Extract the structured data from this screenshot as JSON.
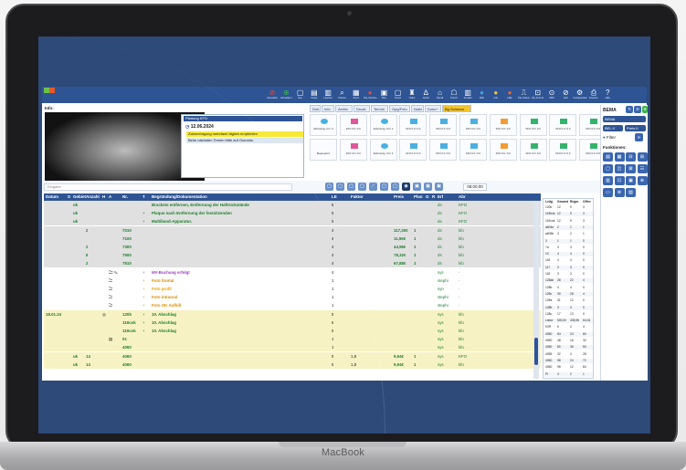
{
  "device": {
    "brand": "MacBook"
  },
  "toolbar": [
    {
      "icon": "⊘",
      "label": "Abmelden",
      "color": "#e24a4a"
    },
    {
      "icon": "⊕",
      "label": "Abmeldern",
      "color": "#39b54a"
    },
    {
      "icon": "▢",
      "label": "Neu"
    },
    {
      "icon": "▤",
      "label": "Kopie"
    },
    {
      "icon": "▥",
      "label": "Löschen"
    },
    {
      "icon": "⌕",
      "label": "Suchen"
    },
    {
      "icon": "▦",
      "label": "Zoom"
    },
    {
      "icon": "●",
      "label": "Pat. löschen",
      "color": "#e24a4a"
    },
    {
      "icon": "▣",
      "label": "Plan"
    },
    {
      "icon": "▢",
      "label": "Druck"
    },
    {
      "icon": "♜",
      "label": "Video"
    },
    {
      "icon": "∆",
      "label": "Aufruf"
    },
    {
      "icon": "⌂",
      "label": "Recall"
    },
    {
      "icon": "☖",
      "label": "Termin"
    },
    {
      "icon": "▥",
      "label": "Kontakt"
    },
    {
      "icon": "●",
      "label": "Web",
      "color": "#4aa3df"
    },
    {
      "icon": "●",
      "label": "Info",
      "color": "#f5c431"
    },
    {
      "icon": "●",
      "label": "Hilfe",
      "color": "#e86a2b"
    },
    {
      "icon": "⎍",
      "label": "Pat.-Status"
    },
    {
      "icon": "⊡",
      "label": "Bg Journal"
    },
    {
      "icon": "⊙",
      "label": "SMS"
    },
    {
      "icon": "⊘",
      "label": "HuK"
    },
    {
      "icon": "⚙",
      "label": "Konfiguration"
    },
    {
      "icon": "⎙",
      "label": "Drucken"
    },
    {
      "icon": "?",
      "label": "Hilfe"
    }
  ],
  "info_label": "Info:",
  "plan": {
    "title": "Planung KFO",
    "date": "12.06.2024",
    "lines": [
      {
        "text": "Zahnreinigung mehrfach täglich empfohlen",
        "bg": "#f7ea36"
      },
      {
        "text": "Beim nächsten Termin bitte auf Gummis",
        "bg": "#dde6f3"
      }
    ]
  },
  "tabs": [
    {
      "label": "Dok"
    },
    {
      "label": "Info"
    },
    {
      "label": "Archiv"
    },
    {
      "label": "Druck"
    },
    {
      "label": "Termin"
    },
    {
      "label": "Opg/Foto"
    },
    {
      "label": "Notiz"
    },
    {
      "label": "Doku+"
    },
    {
      "label": "Bg Schema",
      "active": true
    }
  ],
  "cards": [
    {
      "label": "Zahnreinig. 0.0 / 4",
      "color": "#4bb0e0"
    },
    {
      "label": "KFO 0.0 / 0.0",
      "color": "#e0569b"
    },
    {
      "label": "Zahnreinig. 0.0 / 4",
      "color": "#4bb0e0"
    },
    {
      "label": "KFO 0.0 / 0.0",
      "color": "#4bb0e0"
    },
    {
      "label": "KFO 0.0 / 0.0",
      "color": "#4bb0e0"
    },
    {
      "label": "KFO 0.0 / 0.0",
      "color": "#4bb0e0"
    },
    {
      "label": "KFO 0.0 / 0.0",
      "color": "#f39c32"
    },
    {
      "label": "KFO 0.0 / 0.0",
      "color": "#33b36b"
    },
    {
      "label": "KFO 0.0 / 0.0",
      "color": "#33b36b"
    },
    {
      "label": "KFO 0.0 / 0.0",
      "color": "#33b36b"
    },
    {
      "label": "Bugel-geloz",
      "color": "#ffffff"
    },
    {
      "label": "KFO 0.0 / 0.0",
      "color": "#e0569b"
    },
    {
      "label": "Zahnreinig. 0.0 / 4",
      "color": "#4bb0e0"
    },
    {
      "label": "KFO 0.0 / 0.0",
      "color": "#4bb0e0"
    },
    {
      "label": "KFO 0.0 / 0.0",
      "color": "#4bb0e0"
    },
    {
      "label": "KFO 0.0 / 0.0",
      "color": "#4bb0e0"
    },
    {
      "label": "KFO 0.0 / 0.0",
      "color": "#f39c32"
    },
    {
      "label": "KFO 0.0 / 0.0",
      "color": "#33b36b"
    },
    {
      "label": "KFO 0.0 / 0.0",
      "color": "#33b36b"
    },
    {
      "label": "KFO 0.0 / 0.0",
      "color": "#33b36b"
    }
  ],
  "bema": {
    "label": "BEMA",
    "select1": "BEMA",
    "select2": "BEL II",
    "select3": "Preis II",
    "filter": "Filter",
    "functions": "Funktionen:"
  },
  "search": {
    "placeholder": "Eingabe",
    "time": "08:00:00"
  },
  "columns": [
    "Datum",
    "S",
    "Gebiet",
    "Anzahl",
    "H",
    "A",
    "Nr.",
    "T",
    "Begründung/Dokumentation",
    "LE",
    "Faktor",
    "Preis",
    "Plan",
    "G",
    "R",
    "Erf",
    "Abr"
  ],
  "rows": [
    {
      "bg": "#e0e0e0",
      "gebiet": "ok",
      "nr": "",
      "t": "",
      "text": "Brackets entfernen, Entfernung der Haftrückstände",
      "le": "5",
      "erf": "ds",
      "abr": "KFO",
      "tc": "#1a7f2a"
    },
    {
      "bg": "#e0e0e0",
      "gebiet": "uk",
      "nr": "",
      "t": "+",
      "text": "Plaque nach Entfernung der festsitzenden",
      "le": "5",
      "erf": "ds",
      "abr": "KFO",
      "tc": "#1a7f2a"
    },
    {
      "bg": "#e0e0e0",
      "gebiet": "uk",
      "nr": "",
      "t": "+",
      "text": "Multiband-Apparatur.",
      "le": "5",
      "erf": "ds",
      "abr": "KFO",
      "tc": "#1a7f2a"
    },
    {
      "bg": "#e0e0e0",
      "anzahl": "2",
      "nr": "7010",
      "le": "4",
      "preis": "117,30€",
      "plan": "1",
      "erf": "ds",
      "abr": "kfo"
    },
    {
      "bg": "#e0e0e0",
      "nr": "7100",
      "le": "4",
      "preis": "11,55€",
      "plan": "1",
      "erf": "ds",
      "abr": "kfo"
    },
    {
      "bg": "#e0e0e0",
      "anzahl": "2",
      "nr": "7300",
      "le": "4",
      "preis": "44,96€",
      "plan": "1",
      "erf": "ds",
      "abr": "kfo"
    },
    {
      "bg": "#e0e0e0",
      "anzahl": "8",
      "nr": "7500",
      "le": "4",
      "preis": "78,32€",
      "plan": "1",
      "erf": "ds",
      "abr": "kfo"
    },
    {
      "bg": "#e0e0e0",
      "anzahl": "2",
      "nr": "7510",
      "le": "4",
      "preis": "67,88€",
      "plan": "1",
      "erf": "ds",
      "abr": "kfo"
    },
    {
      "bg": "#ffffff",
      "a": "🗀 ✎",
      "t": "+",
      "text": "MV-Buchung erfolgt",
      "le": "4",
      "erf": "sys",
      "abr": "-",
      "tc": "#9c3dba"
    },
    {
      "bg": "#ffffff",
      "a": "🗀",
      "t": "+",
      "text": "Foto frontal",
      "le": "1",
      "erf": "stephi",
      "abr": "-",
      "tc": "#d98a00"
    },
    {
      "bg": "#ffffff",
      "a": "🗀",
      "t": "+",
      "text": "Foto profil",
      "le": "1",
      "erf": "syn",
      "abr": "-",
      "tc": "#e8a200"
    },
    {
      "bg": "#ffffff",
      "a": "🗀",
      "t": "+",
      "text": "Foto intraoral",
      "le": "1",
      "erf": "stephi",
      "abr": "-",
      "tc": "#d98a00"
    },
    {
      "bg": "#ffffff",
      "a": "🗀",
      "t": "+",
      "text": "Foto OK Aufbiß",
      "le": "1",
      "erf": "stephi",
      "abr": "-",
      "tc": "#d98a00"
    },
    {
      "bg": "#f7f2c4",
      "datum": "18.01.24",
      "h": "◎",
      "nr": "120b",
      "t": "+",
      "text": "10. Abschlag",
      "le": "5",
      "erf": "sys",
      "abr": "kfo",
      "tc": "#1a7f2a"
    },
    {
      "bg": "#f7f2c4",
      "nr": "119cok",
      "t": "+",
      "text": "10. Abschlag",
      "le": "5",
      "erf": "sys",
      "abr": "kfo",
      "tc": "#1a7f2a"
    },
    {
      "bg": "#f7f2c4",
      "nr": "119cok",
      "t": "+",
      "text": "10. Abschlag",
      "le": "5",
      "erf": "sys",
      "abr": "kfo",
      "tc": "#1a7f2a"
    },
    {
      "bg": "#f7f2c4",
      "a": "▤",
      "nr": "01",
      "le": "1",
      "erf": "sys",
      "abr": "kfo"
    },
    {
      "bg": "#f7f2c4",
      "nr": "4060",
      "le": "1",
      "erf": "sys",
      "abr": "kfo"
    },
    {
      "bg": "#f7f2c4",
      "gebiet": "uk",
      "anzahl": "14",
      "nr": "4060",
      "le": "5",
      "faktor": "1,8",
      "preis": "9,94€",
      "plan": "1",
      "erf": "sys",
      "abr": "KFO"
    },
    {
      "bg": "#f7f2c4",
      "gebiet": "uk",
      "anzahl": "14",
      "nr": "4060",
      "le": "5",
      "faktor": "1,8",
      "preis": "9,94€",
      "plan": "1",
      "erf": "sys",
      "abr": "kfo"
    }
  ],
  "side_table": {
    "headers": [
      "Leitg",
      "Gesamt",
      "Regm.",
      "Offen"
    ],
    "rows": [
      [
        "120b",
        "12",
        "9",
        "3"
      ],
      [
        "119bok",
        "12",
        "9",
        "3"
      ],
      [
        "119cok",
        "12",
        "9",
        "3"
      ],
      [
        "a604e",
        "2",
        "1",
        "1"
      ],
      [
        "a605b",
        "3",
        "2",
        "1"
      ],
      [
        "3",
        "1",
        "1",
        "0"
      ],
      [
        "7a",
        "3",
        "3",
        "0"
      ],
      [
        "10",
        "4",
        "4",
        "0"
      ],
      [
        "118",
        "4",
        "4",
        "0"
      ],
      [
        "117",
        "3",
        "3",
        "0"
      ],
      [
        "118",
        "3",
        "3",
        "0"
      ],
      [
        "128ab",
        "28",
        "22",
        "4"
      ],
      [
        "128b",
        "4",
        "4",
        "0"
      ],
      [
        "128c",
        "30",
        "28",
        "4"
      ],
      [
        "128a",
        "31",
        "12",
        "0"
      ],
      [
        "128b",
        "3",
        "3",
        "0"
      ],
      [
        "128c",
        "17",
        "13",
        "0"
      ],
      [
        "Labor",
        "500,00",
        "435,96",
        "64,04"
      ],
      [
        "K2R",
        "6",
        "2",
        "4"
      ],
      [
        "4060",
        "84",
        "24",
        "60"
      ],
      [
        "4050",
        "48",
        "16",
        "32"
      ],
      [
        "4050",
        "80",
        "36",
        "60"
      ],
      [
        "4055",
        "32",
        "4",
        "28"
      ],
      [
        "4060",
        "98",
        "24",
        "72"
      ],
      [
        "4060",
        "98",
        "12",
        "84"
      ],
      [
        "PI",
        "3",
        "2",
        "1"
      ]
    ]
  }
}
